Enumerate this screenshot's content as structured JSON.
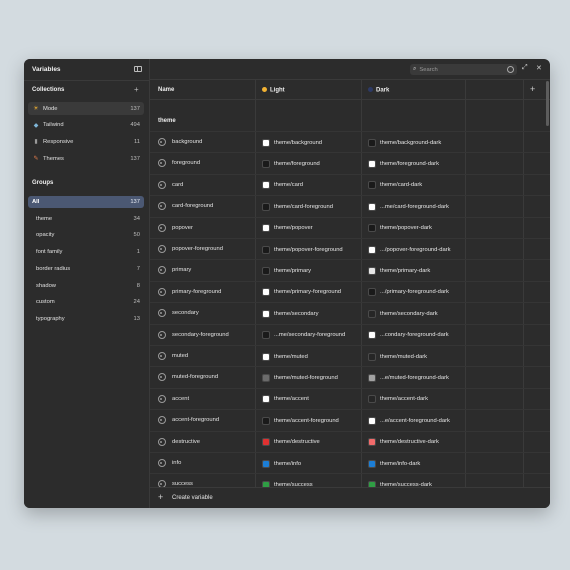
{
  "sidebar": {
    "title": "Variables",
    "collections_header": "Collections",
    "collections": [
      {
        "label": "Mode",
        "count": "137",
        "icon": "sun-icon",
        "glyph": "☀",
        "color": "#f2b233"
      },
      {
        "label": "Tailwind",
        "count": "494",
        "icon": "tailwind-icon",
        "glyph": "◆",
        "color": "#7fb6d8"
      },
      {
        "label": "Responsive",
        "count": "11",
        "icon": "responsive-icon",
        "glyph": "▮",
        "color": "#9a9a9a"
      },
      {
        "label": "Themes",
        "count": "137",
        "icon": "brush-icon",
        "glyph": "✎",
        "color": "#e67e4d"
      }
    ],
    "groups_header": "Groups",
    "groups": [
      {
        "label": "All",
        "count": "137"
      },
      {
        "label": "theme",
        "count": "34"
      },
      {
        "label": "opacity",
        "count": "50"
      },
      {
        "label": "font family",
        "count": "1"
      },
      {
        "label": "border radius",
        "count": "7"
      },
      {
        "label": "shadow",
        "count": "8"
      },
      {
        "label": "custom",
        "count": "24"
      },
      {
        "label": "typography",
        "count": "13"
      }
    ]
  },
  "search": {
    "placeholder": "Search"
  },
  "columns": {
    "name": "Name",
    "light": "Light",
    "dark": "Dark",
    "light_color": "#f2b233",
    "dark_color": "#2d3a66"
  },
  "group_label": "theme",
  "rows": [
    {
      "name": "background",
      "light": "theme/background",
      "light_color": "#ffffff",
      "dark": "theme/background-dark",
      "dark_color": "#1a1a1a"
    },
    {
      "name": "foreground",
      "light": "theme/foreground",
      "light_color": "#1a1a1a",
      "dark": "theme/foreground-dark",
      "dark_color": "#ffffff"
    },
    {
      "name": "card",
      "light": "theme/card",
      "light_color": "#ffffff",
      "dark": "theme/card-dark",
      "dark_color": "#1a1a1a"
    },
    {
      "name": "card-foreground",
      "light": "theme/card-foreground",
      "light_color": "#1a1a1a",
      "dark": "...me/card-foreground-dark",
      "dark_color": "#ffffff"
    },
    {
      "name": "popover",
      "light": "theme/popover",
      "light_color": "#ffffff",
      "dark": "theme/popover-dark",
      "dark_color": "#1a1a1a"
    },
    {
      "name": "popover-foreground",
      "light": "theme/popover-foreground",
      "light_color": "#1a1a1a",
      "dark": ".../popover-foreground-dark",
      "dark_color": "#ffffff"
    },
    {
      "name": "primary",
      "light": "theme/primary",
      "light_color": "#1a1a1a",
      "dark": "theme/primary-dark",
      "dark_color": "#e6e6e6"
    },
    {
      "name": "primary-foreground",
      "light": "theme/primary-foreground",
      "light_color": "#ffffff",
      "dark": ".../primary-foreground-dark",
      "dark_color": "#1a1a1a"
    },
    {
      "name": "secondary",
      "light": "theme/secondary",
      "light_color": "#ffffff",
      "dark": "theme/secondary-dark",
      "dark_color": "#262626"
    },
    {
      "name": "secondary-foreground",
      "light": "...me/secondary-foreground",
      "light_color": "#1a1a1a",
      "dark": "...condary-foreground-dark",
      "dark_color": "#ffffff"
    },
    {
      "name": "muted",
      "light": "theme/muted",
      "light_color": "#ffffff",
      "dark": "theme/muted-dark",
      "dark_color": "#262626"
    },
    {
      "name": "muted-foreground",
      "light": "theme/muted-foreground",
      "light_color": "#6b6b6b",
      "dark": "...e/muted-foreground-dark",
      "dark_color": "#a3a3a3"
    },
    {
      "name": "accent",
      "light": "theme/accent",
      "light_color": "#ffffff",
      "dark": "theme/accent-dark",
      "dark_color": "#262626"
    },
    {
      "name": "accent-foreground",
      "light": "theme/accent-foreground",
      "light_color": "#1a1a1a",
      "dark": "...e/accent-foreground-dark",
      "dark_color": "#ffffff"
    },
    {
      "name": "destructive",
      "light": "theme/destructive",
      "light_color": "#e03131",
      "dark": "theme/destructive-dark",
      "dark_color": "#f26b6b"
    },
    {
      "name": "info",
      "light": "theme/info",
      "light_color": "#1c7ed6",
      "dark": "theme/info-dark",
      "dark_color": "#1c7ed6"
    },
    {
      "name": "success",
      "light": "theme/success",
      "light_color": "#2f9e44",
      "dark": "theme/success-dark",
      "dark_color": "#2f9e44"
    }
  ],
  "footer": {
    "create_label": "Create variable"
  }
}
